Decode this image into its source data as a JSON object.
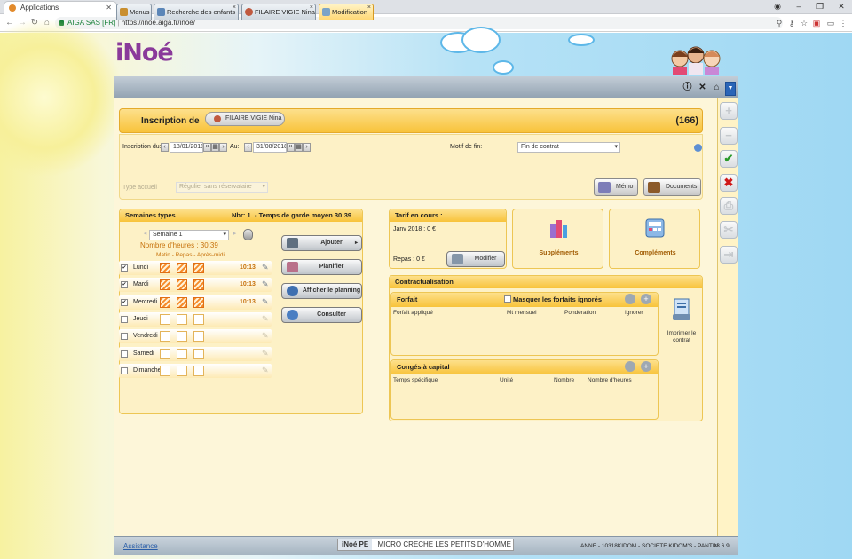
{
  "browser": {
    "tab_title": "Applications",
    "address_secure": "AIGA SAS [FR]",
    "url": "https://inoe.aiga.fr/inoe/"
  },
  "app": {
    "logo": "iNoé",
    "tabs": [
      {
        "label": "Menus"
      },
      {
        "label": "Recherche des enfants"
      },
      {
        "label": "FILAIRE VIGIE Nina"
      },
      {
        "label": "Modification"
      }
    ]
  },
  "header": {
    "title": "Inscription de",
    "child_name": "FILAIRE VIGIE Nina",
    "count": "(166)"
  },
  "form": {
    "inscription_du_label": "Inscription du:",
    "date_from": "18/01/2018",
    "au_label": "Au:",
    "date_to": "31/08/2018",
    "motif_label": "Motif de fin:",
    "motif_value": "Fin de contrat",
    "type_accueil_label": "Type accueil",
    "type_accueil_value": "Régulier sans réservataire",
    "memo_label": "Mémo",
    "documents_label": "Documents"
  },
  "semaines": {
    "title": "Semaines types",
    "nbr": "Nbr: 1",
    "temps": "- Temps de garde moyen 30:39",
    "selected_week": "Semaine 1",
    "hours": "Nombre d'heures : 30:39",
    "columns": "Matin - Repas - Après-midi",
    "days": [
      {
        "name": "Lundi",
        "checked": true,
        "time": "10:13"
      },
      {
        "name": "Mardi",
        "checked": true,
        "time": "10:13"
      },
      {
        "name": "Mercredi",
        "checked": true,
        "time": "10:13"
      },
      {
        "name": "Jeudi",
        "checked": false,
        "time": ""
      },
      {
        "name": "Vendredi",
        "checked": false,
        "time": ""
      },
      {
        "name": "Samedi",
        "checked": false,
        "time": ""
      },
      {
        "name": "Dimanche",
        "checked": false,
        "time": ""
      }
    ],
    "actions": {
      "ajouter": "Ajouter",
      "planifier": "Planifier",
      "afficher": "Afficher le planning",
      "consulter": "Consulter"
    }
  },
  "tarif": {
    "title": "Tarif en cours :",
    "period": "Janv 2018 : 0 €",
    "repas": "Repas : 0 €",
    "modifier": "Modifier"
  },
  "supplements": "Suppléments",
  "complements": "Compléments",
  "contract": {
    "title": "Contractualisation",
    "forfait_title": "Forfait",
    "masquer": "Masquer les forfaits ignorés",
    "forfait_cols": [
      "Forfait appliqué",
      "Mt mensuel",
      "Pondération",
      "Ignorer"
    ],
    "conges_title": "Congés à capital",
    "conges_cols": [
      "Temps spécifique",
      "Unité",
      "Nombre",
      "Nombre d'heures"
    ],
    "imprimer": "Imprimer le contrat"
  },
  "footer": {
    "assistance": "Assistance",
    "product": "iNoé PE",
    "structure": "MICRO CRECHE LES PETITS D'HOMME",
    "user": "ANNE - 10318KIDOM - SOCIETE KIDOM'S - PANTIN",
    "version": "v3.6.9"
  }
}
